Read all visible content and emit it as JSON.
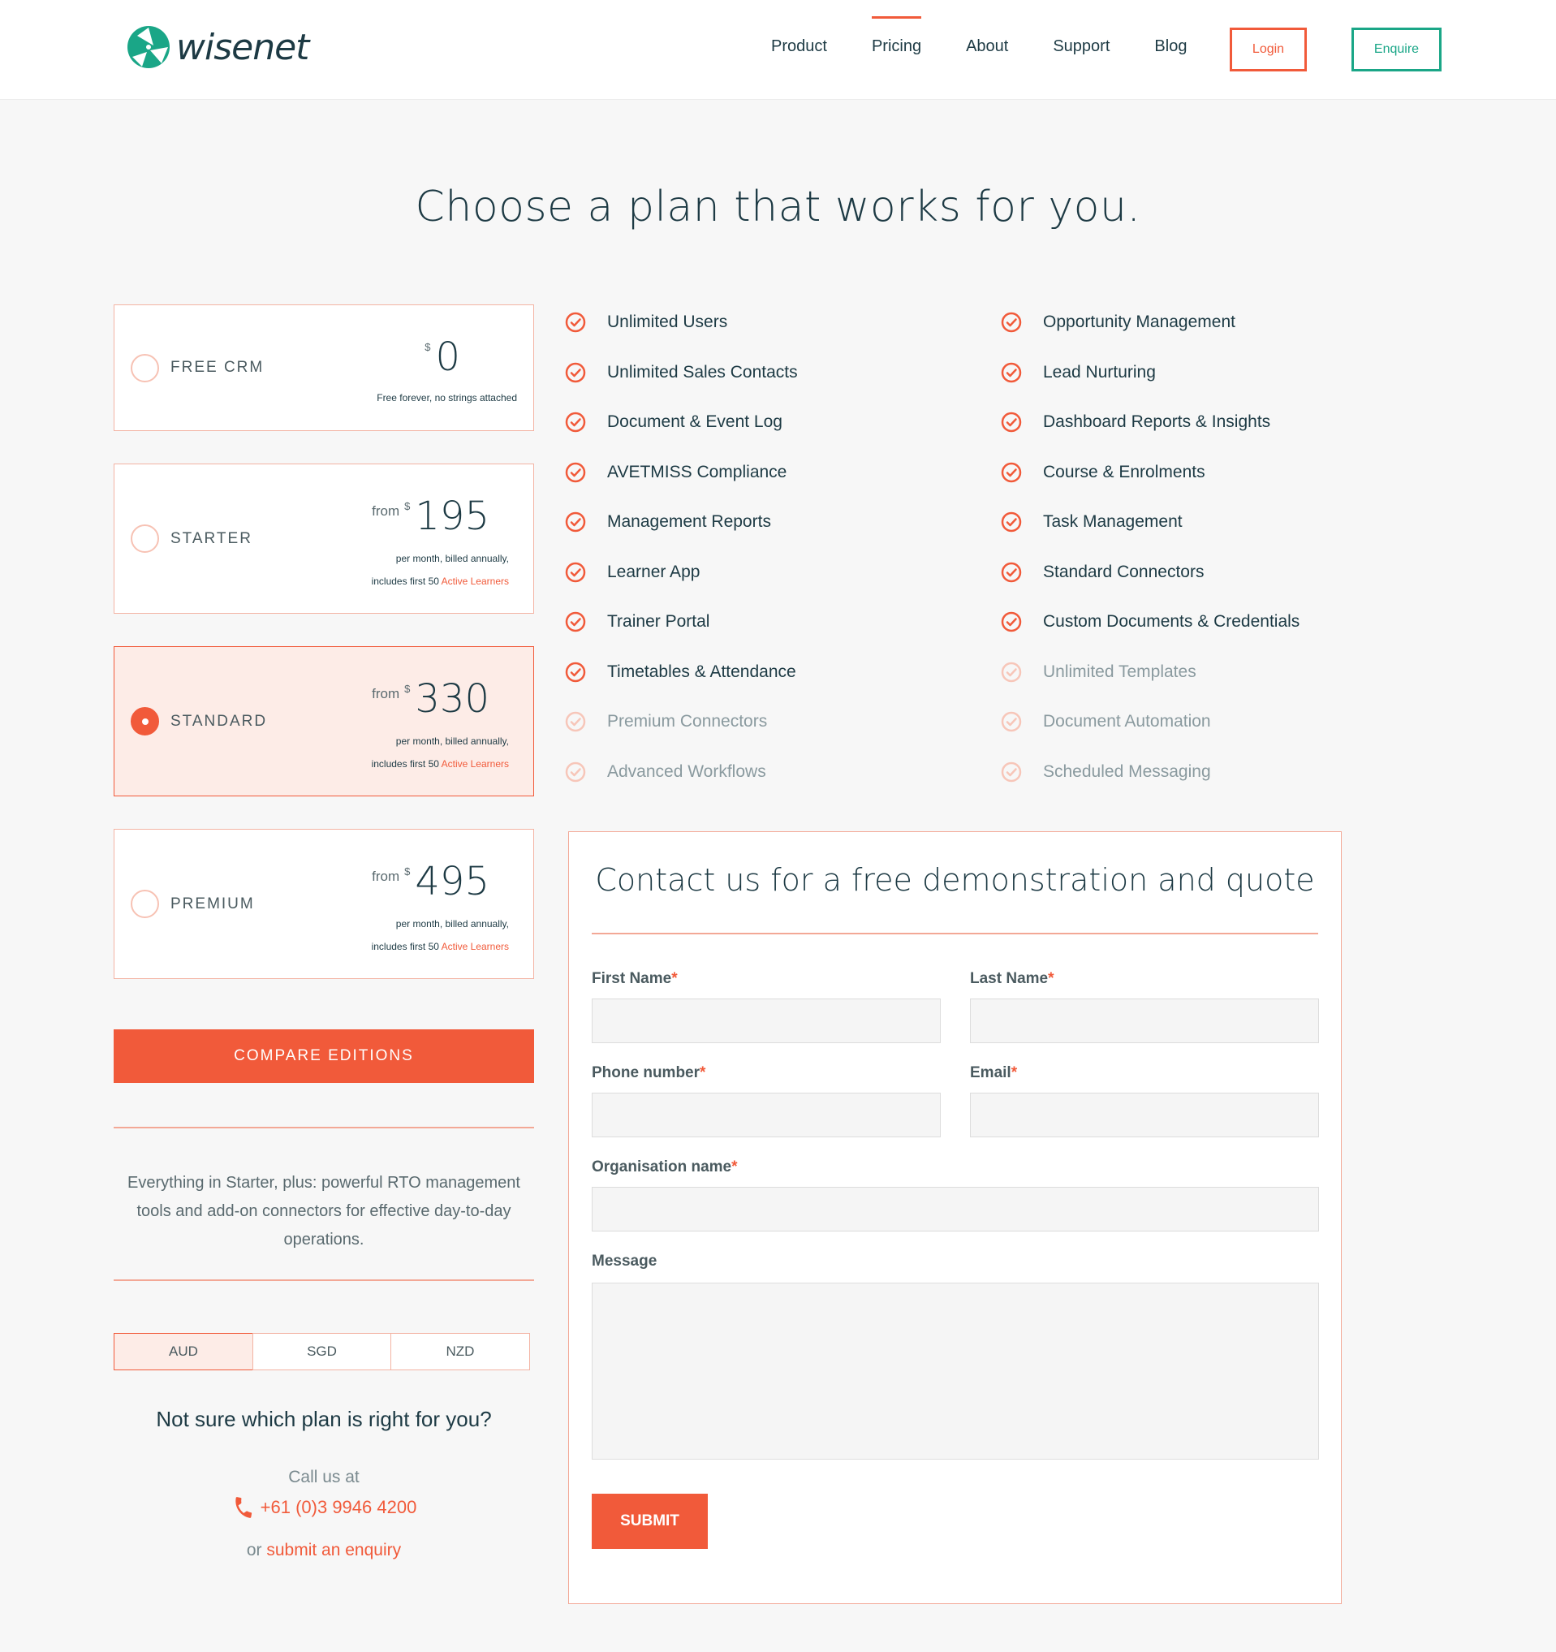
{
  "header": {
    "logo_text": "wisenet",
    "nav": [
      "Product",
      "Pricing",
      "About",
      "Support",
      "Blog"
    ],
    "active_nav": "Pricing",
    "login_label": "Login",
    "enquire_label": "Enquire"
  },
  "title": "Choose a plan that works for you.",
  "plans": [
    {
      "name": "FREE CRM",
      "from": "",
      "currency": "$",
      "amount": "0",
      "note1": "Free forever, no strings attached",
      "note2": "",
      "note2_link": "",
      "selected": false
    },
    {
      "name": "STARTER",
      "from": "from",
      "currency": "$",
      "amount": "195",
      "note1": "per month, billed annually,",
      "note2": "includes first 50 ",
      "note2_link": "Active Learners",
      "selected": false
    },
    {
      "name": "STANDARD",
      "from": "from",
      "currency": "$",
      "amount": "330",
      "note1": "per month, billed annually,",
      "note2": "includes first 50 ",
      "note2_link": "Active Learners",
      "selected": true
    },
    {
      "name": "PREMIUM",
      "from": "from",
      "currency": "$",
      "amount": "495",
      "note1": "per month, billed annually,",
      "note2": "includes first 50 ",
      "note2_link": "Active Learners",
      "selected": false
    }
  ],
  "compare_label": "COMPARE EDITIONS",
  "plan_description": "Everything in Starter, plus: powerful RTO management tools and add-on connectors for effective day-to-day operations.",
  "currencies": [
    "AUD",
    "SGD",
    "NZD"
  ],
  "active_currency": "AUD",
  "help": {
    "title": "Not sure which plan is right for you?",
    "call_label": "Call us at",
    "phone": "+61 (0)3 9946 4200",
    "or": "or ",
    "enquiry_link": "submit an enquiry"
  },
  "features_left": [
    {
      "label": "Unlimited Users",
      "included": true
    },
    {
      "label": "Unlimited Sales Contacts",
      "included": true
    },
    {
      "label": "Document & Event Log",
      "included": true
    },
    {
      "label": "AVETMISS Compliance",
      "included": true
    },
    {
      "label": "Management Reports",
      "included": true
    },
    {
      "label": "Learner App",
      "included": true
    },
    {
      "label": "Trainer Portal",
      "included": true
    },
    {
      "label": "Timetables & Attendance",
      "included": true
    },
    {
      "label": "Premium Connectors",
      "included": false
    },
    {
      "label": "Advanced Workflows",
      "included": false
    }
  ],
  "features_right": [
    {
      "label": "Opportunity Management",
      "included": true
    },
    {
      "label": "Lead Nurturing",
      "included": true
    },
    {
      "label": "Dashboard Reports & Insights",
      "included": true
    },
    {
      "label": "Course & Enrolments",
      "included": true
    },
    {
      "label": "Task Management",
      "included": true
    },
    {
      "label": "Standard Connectors",
      "included": true
    },
    {
      "label": "Custom Documents & Credentials",
      "included": true
    },
    {
      "label": "Unlimited Templates",
      "included": false
    },
    {
      "label": "Document Automation",
      "included": false
    },
    {
      "label": "Scheduled Messaging",
      "included": false
    }
  ],
  "contact": {
    "title": "Contact us for a free demonstration and quote",
    "first_name": "First Name",
    "last_name": "Last Name",
    "phone": "Phone number",
    "email": "Email",
    "organisation": "Organisation name",
    "message": "Message",
    "required_mark": "*",
    "submit": "SUBMIT"
  },
  "colors": {
    "accent": "#f15a3a",
    "brand_green": "#1aa687",
    "text": "#1d3a44"
  }
}
